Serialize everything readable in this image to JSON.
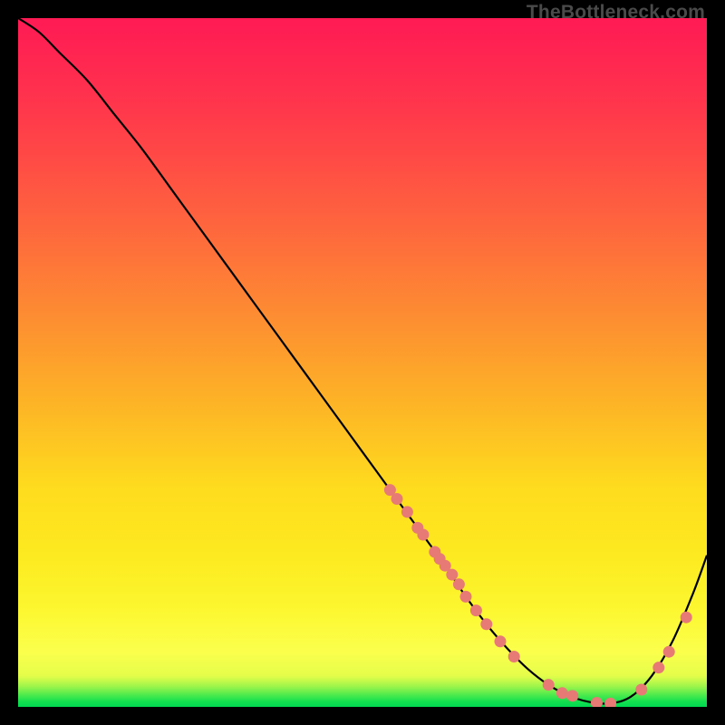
{
  "watermark": "TheBottleneck.com",
  "chart_data": {
    "type": "line",
    "title": "",
    "xlabel": "",
    "ylabel": "",
    "xlim": [
      0,
      100
    ],
    "ylim": [
      0,
      100
    ],
    "curve": {
      "name": "bottleneck-curve",
      "x": [
        0,
        3,
        6,
        10,
        14,
        18,
        22,
        26,
        30,
        34,
        38,
        42,
        46,
        50,
        54,
        58,
        62,
        65,
        68,
        71,
        74,
        77,
        80,
        83,
        86,
        89,
        92,
        95,
        98,
        100
      ],
      "y": [
        100,
        98,
        95,
        91,
        86,
        81,
        75.5,
        70,
        64.5,
        59,
        53.5,
        48,
        42.5,
        37,
        31.5,
        26,
        20.5,
        16,
        12,
        8.5,
        5.5,
        3.2,
        1.6,
        0.7,
        0.5,
        1.5,
        4.5,
        9.5,
        16.5,
        22
      ]
    },
    "points": {
      "name": "highlight-dots",
      "x": [
        54.0,
        55.0,
        56.5,
        58.0,
        58.8,
        60.5,
        61.2,
        62.0,
        63.0,
        64.0,
        65.0,
        66.5,
        68.0,
        70.0,
        72.0,
        77.0,
        79.0,
        80.5,
        84.0,
        86.0,
        90.5,
        93.0,
        94.5,
        97.0
      ],
      "y": [
        31.5,
        30.2,
        28.3,
        26.0,
        25.0,
        22.5,
        21.5,
        20.5,
        19.2,
        17.8,
        16.0,
        14.0,
        12.0,
        9.5,
        7.3,
        3.2,
        2.0,
        1.6,
        0.6,
        0.5,
        2.5,
        5.7,
        8.0,
        13.0
      ]
    },
    "gradient_stops": [
      {
        "pos": 0.0,
        "color": "#ff1a54"
      },
      {
        "pos": 0.32,
        "color": "#fe6b3c"
      },
      {
        "pos": 0.68,
        "color": "#fedb1e"
      },
      {
        "pos": 0.92,
        "color": "#fbff4c"
      },
      {
        "pos": 1.0,
        "color": "#00d850"
      }
    ]
  }
}
